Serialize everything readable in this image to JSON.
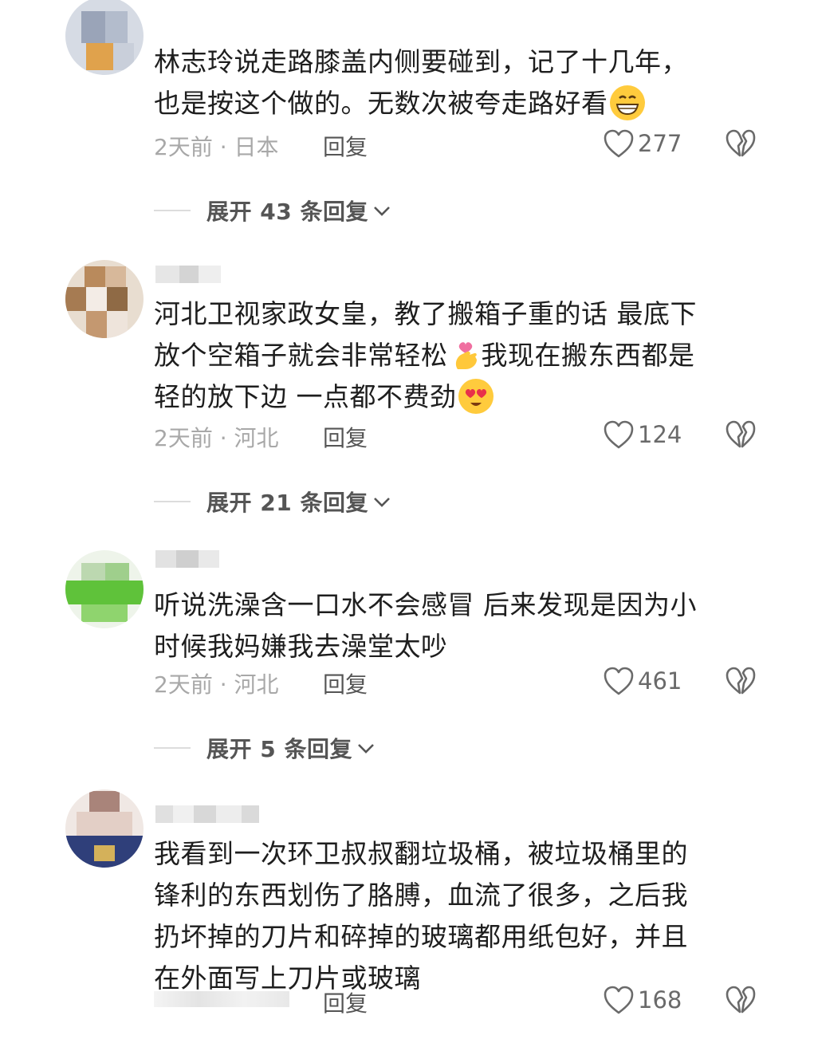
{
  "comments": [
    {
      "text_lines": [
        "林志玲说走路膝盖内侧要碰到，记了十几年，",
        "也是按这个做的。无数次被夸走路好看"
      ],
      "emoji": "grinning-face-emoji",
      "time_location": "2天前 · 日本",
      "reply_label": "回复",
      "likes": "277",
      "expand_label": "展开 43 条回复"
    },
    {
      "text_lines": [
        "河北卫视家政女皇，教了搬箱子重的话  最底下",
        "放个空箱子就会非常轻松",
        "我现在搬东西都是",
        "轻的放下边  一点都不费劲"
      ],
      "emoji": "heart-eyes-emoji",
      "time_location": "2天前 · 河北",
      "reply_label": "回复",
      "likes": "124",
      "expand_label": "展开 21 条回复"
    },
    {
      "text_lines": [
        "听说洗澡含一口水不会感冒  后来发现是因为小",
        "时候我妈嫌我去澡堂太吵"
      ],
      "time_location": "2天前 · 河北",
      "reply_label": "回复",
      "likes": "461",
      "expand_label": "展开 5 条回复"
    },
    {
      "text_lines": [
        "我看到一次环卫叔叔翻垃圾桶，被垃圾桶里的",
        "锋利的东西划伤了胳膊，血流了很多，之后我",
        "扔坏掉的刀片和碎掉的玻璃都用纸包好，并且",
        "在外面写上刀片或玻璃"
      ],
      "reply_label": "回复",
      "likes": "168"
    }
  ],
  "icons": {
    "like": "heart-outline-icon",
    "dislike": "broken-heart-icon",
    "expand": "chevron-down-icon",
    "finger_heart": "finger-heart-emoji"
  },
  "colors": {
    "text": "#1e1e1e",
    "meta": "#a8a8a8",
    "reply": "#555555",
    "emoji_yellow": "#ffcb3d"
  }
}
